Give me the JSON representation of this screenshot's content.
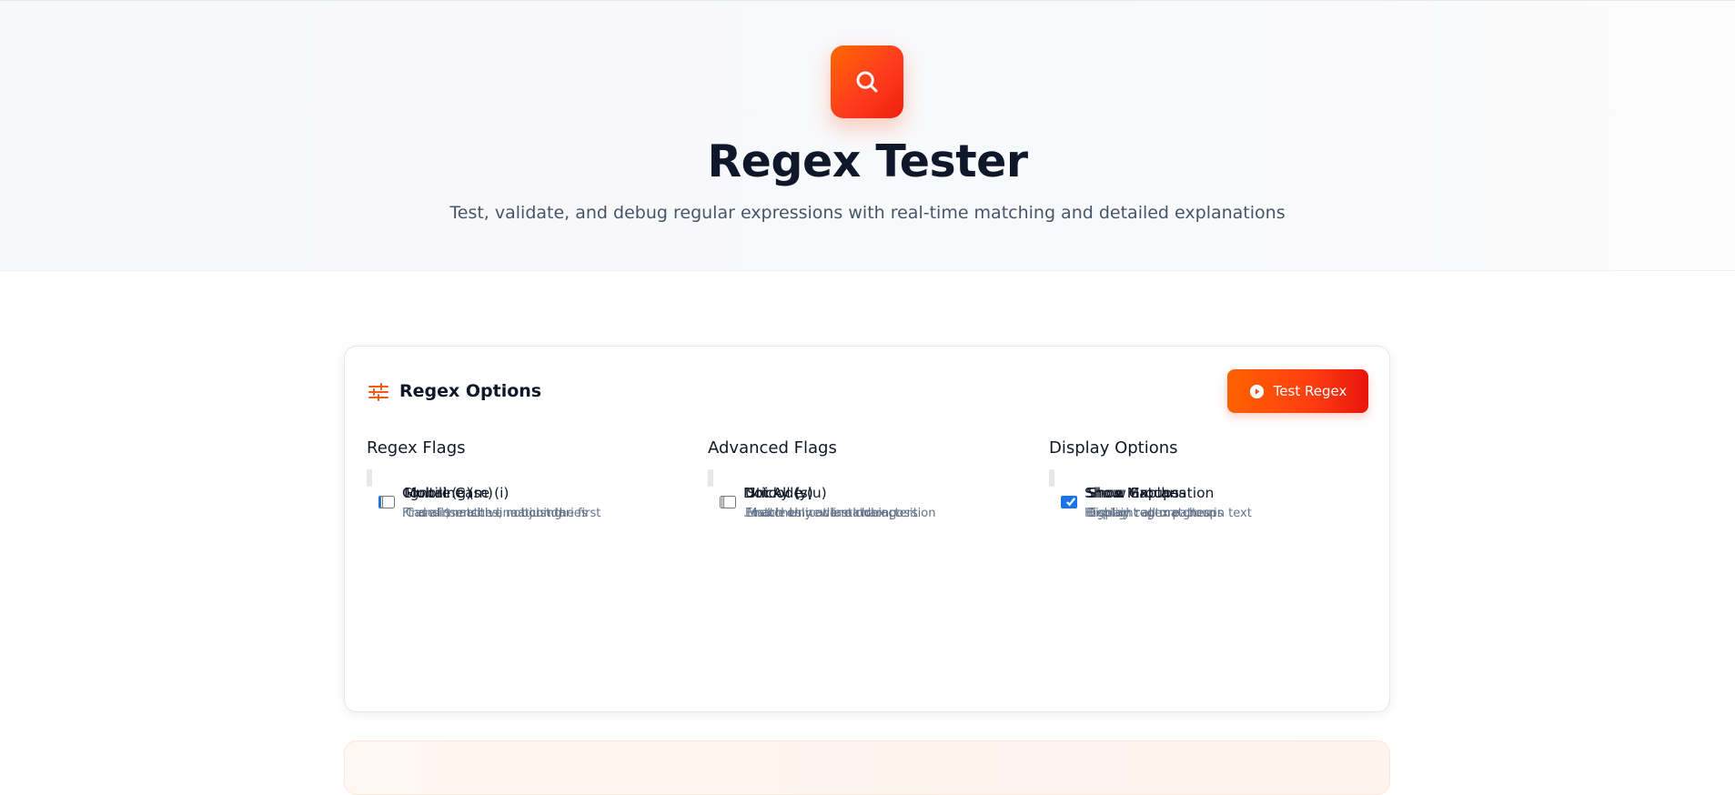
{
  "hero": {
    "logo_icon": "search-icon",
    "title": "Regex Tester",
    "subtitle": "Test, validate, and debug regular expressions with real-time matching and detailed explanations",
    "accent_color": "#ff4d0a"
  },
  "options_card": {
    "icon": "sliders-icon",
    "title": "Regex Options",
    "test_button": {
      "icon": "play-circle-icon",
      "label": "Test Regex"
    },
    "columns": [
      {
        "heading": "Regex Flags",
        "options": [
          {
            "label": "Global (g)",
            "description": "Find all matches, not just the first",
            "checked": true
          },
          {
            "label": "Multiline (m)",
            "description": "^ and $ match line boundaries",
            "checked": false
          },
          {
            "label": "Ignore Case (i)",
            "description": "Case-insensitive matching",
            "checked": false
          }
        ]
      },
      {
        "heading": "Advanced Flags",
        "options": [
          {
            "label": "Dot All (s)",
            "description": ". matches newline characters",
            "checked": false
          },
          {
            "label": "Unicode (u)",
            "description": "Enable Unicode matching",
            "checked": false
          },
          {
            "label": "Sticky (y)",
            "description": "Match only at lastIndex position",
            "checked": false
          }
        ]
      },
      {
        "heading": "Display Options",
        "options": [
          {
            "label": "Show Matches",
            "description": "Highlight all matches in text",
            "checked": true
          },
          {
            "label": "Show Groups",
            "description": "Display capture groups",
            "checked": true
          },
          {
            "label": "Show Explanation",
            "description": "Explain regex pattern",
            "checked": true
          }
        ]
      }
    ]
  }
}
